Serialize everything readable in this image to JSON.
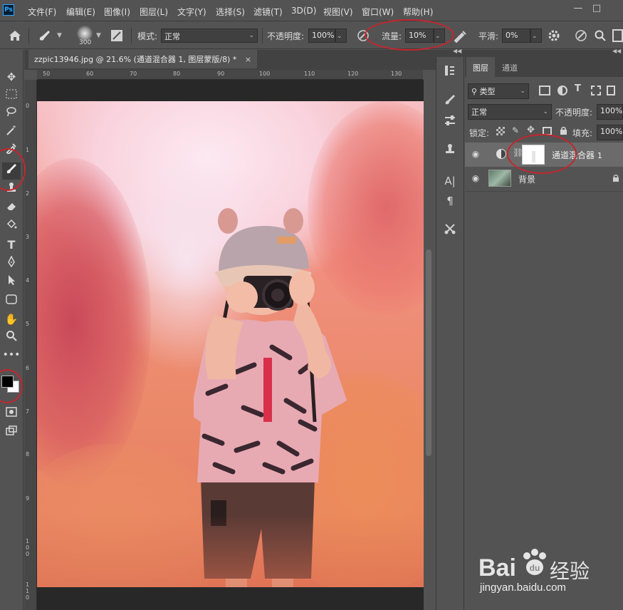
{
  "app": {
    "logo": "Ps"
  },
  "menu": [
    "文件(F)",
    "编辑(E)",
    "图像(I)",
    "图层(L)",
    "文字(Y)",
    "选择(S)",
    "滤镜(T)",
    "3D(D)",
    "视图(V)",
    "窗口(W)",
    "帮助(H)"
  ],
  "window_controls": {
    "minimize": "—",
    "restore": "□"
  },
  "options": {
    "brush_size": "300",
    "mode_label": "模式:",
    "mode_value": "正常",
    "opacity_label": "不透明度:",
    "opacity_value": "100%",
    "flow_label": "流量:",
    "flow_value": "10%",
    "smooth_label": "平滑:",
    "smooth_value": "0%"
  },
  "tools": [
    "move-icon",
    "marquee-icon",
    "lasso-icon",
    "magic-wand-icon",
    "eyedropper-icon",
    "brush-icon",
    "stamp-icon",
    "eraser-icon",
    "bucket-icon",
    "type-icon",
    "pen-icon",
    "path-select-icon",
    "rectangle-icon",
    "hand-icon",
    "zoom-icon",
    "more-icon",
    "color-swatch-icon",
    "quick-mask-icon",
    "screen-mode-icon"
  ],
  "document": {
    "tab_title": "zzpic13946.jpg @ 21.6% (通道混合器 1, 图层蒙版/8) *",
    "close": "×"
  },
  "ruler_top": [
    "50",
    "60",
    "70",
    "80",
    "90",
    "100",
    "110",
    "120",
    "130"
  ],
  "ruler_left": [
    "0",
    "1",
    "2",
    "3",
    "4",
    "5",
    "6",
    "7",
    "8",
    "9",
    "1\n0\n0",
    "1\n1\n0"
  ],
  "layers_panel": {
    "tabs": [
      "图层",
      "通道"
    ],
    "filter_value": "类型",
    "blend_mode": "正常",
    "opacity_label": "不透明度:",
    "opacity_value": "100%",
    "lock_label": "锁定:",
    "fill_label": "填充:",
    "fill_value": "100%",
    "layers": [
      {
        "name": "通道混合器",
        "number": "1"
      },
      {
        "name": "背景"
      }
    ]
  },
  "watermark": {
    "brand_left": "Bai",
    "brand_right": "经验",
    "url": "jingyan.baidu.com"
  },
  "colors": {
    "annotation": "#c4262e",
    "panel_bg": "#535353",
    "accent": "#31a8ff"
  }
}
